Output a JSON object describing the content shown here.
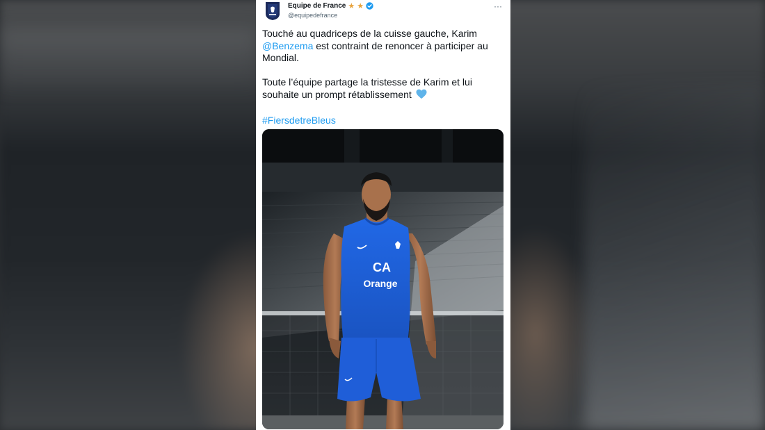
{
  "tweet": {
    "author_name": "Equipe de France",
    "author_handle": "@equipedefrance",
    "paragraph1_part1": "Touché au quadriceps de la cuisse gauche, Karim",
    "mention": "@Benzema",
    "paragraph1_part2": " est contraint de renoncer à participer au Mondial.",
    "paragraph2": "Toute l’équipe partage la tristesse de Karim et lui souhaite un prompt rétablissement ",
    "hashtag": "#FiersdetreBleus",
    "more_label": "···"
  },
  "photo": {
    "jersey_sponsor_line1": "CA",
    "jersey_sponsor_line2": "Orange"
  },
  "colors": {
    "link": "#1d9bf0",
    "jersey": "#1f5ed8",
    "star": "#e8a33d",
    "verified": "#1d9bf0",
    "heart": "#5fb4ea"
  },
  "icons": [
    "fff-crest-icon",
    "star-icon",
    "verified-icon",
    "more-icon",
    "blue-heart-icon"
  ]
}
